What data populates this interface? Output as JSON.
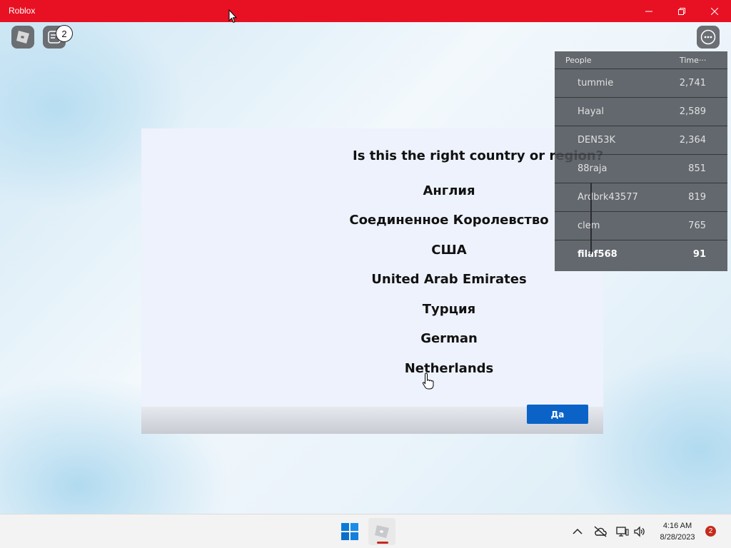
{
  "window": {
    "title": "Roblox",
    "accent_color": "#e81123"
  },
  "top_controls": {
    "chat_badge_count": "2"
  },
  "dialog": {
    "question": "Is this the right country or region?",
    "options": [
      "Англия",
      "Соединенное Королевство",
      "США",
      "United Arab Emirates",
      "Турция",
      "German",
      "Netherlands"
    ],
    "confirm_label": "Да",
    "confirm_color": "#0b63c8"
  },
  "leaderboard": {
    "header_people": "People",
    "header_stat": "Time···",
    "rows": [
      {
        "name": "tummie",
        "value": "2,741"
      },
      {
        "name": "Hayal",
        "value": "2,589"
      },
      {
        "name": "DEN53K",
        "value": "2,364"
      },
      {
        "name": "88raja",
        "value": "851"
      },
      {
        "name": "Ardbrk43577",
        "value": "819"
      },
      {
        "name": "clem",
        "value": "765"
      },
      {
        "name": "filaf568",
        "value": "91"
      }
    ]
  },
  "taskbar": {
    "time": "4:16 AM",
    "date": "8/28/2023",
    "notification_count": "2",
    "icons": [
      "windows-start-icon",
      "roblox-app-icon",
      "chevron-up-icon",
      "cloud-off-icon",
      "network-icon",
      "volume-icon"
    ]
  }
}
